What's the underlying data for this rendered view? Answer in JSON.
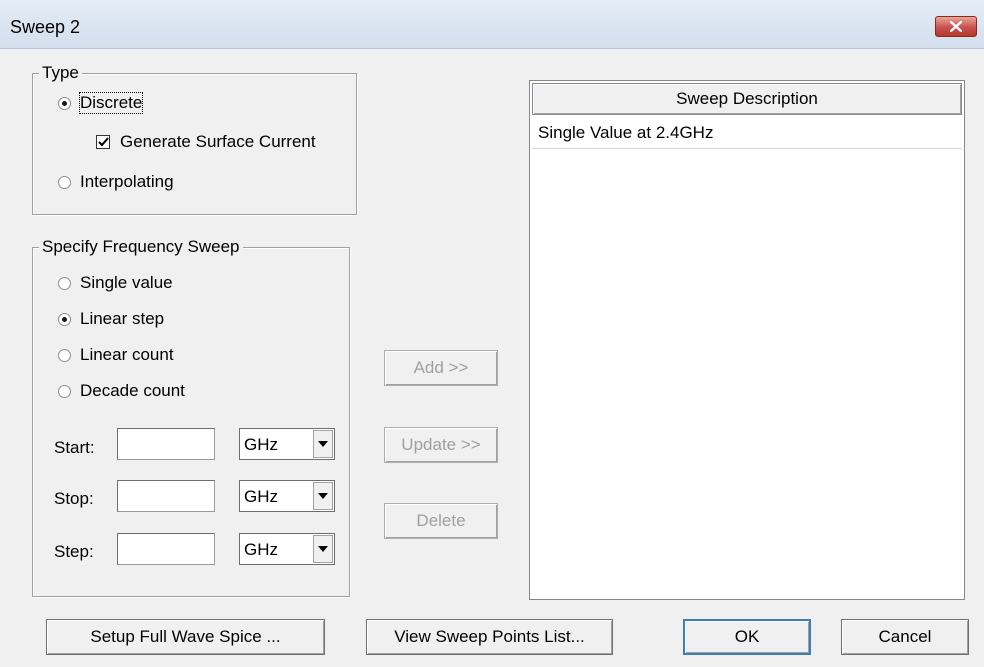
{
  "window": {
    "title": "Sweep 2"
  },
  "type_group": {
    "label": "Type",
    "options": [
      {
        "label": "Discrete",
        "checked": true
      },
      {
        "label": "Interpolating",
        "checked": false
      }
    ],
    "generate_surface_current": {
      "label": "Generate Surface Current",
      "checked": true
    }
  },
  "frequency_group": {
    "label": "Specify Frequency Sweep",
    "options": [
      {
        "label": "Single value",
        "checked": false
      },
      {
        "label": "Linear step",
        "checked": true
      },
      {
        "label": "Linear count",
        "checked": false
      },
      {
        "label": "Decade count",
        "checked": false
      }
    ],
    "fields": [
      {
        "label": "Start:",
        "value": "",
        "unit": "GHz"
      },
      {
        "label": "Stop:",
        "value": "",
        "unit": "GHz"
      },
      {
        "label": "Step:",
        "value": "",
        "unit": "GHz"
      }
    ]
  },
  "middle_buttons": {
    "add": "Add >>",
    "update": "Update >>",
    "delete": "Delete"
  },
  "sweep_list": {
    "header": "Sweep Description",
    "rows": [
      "Single Value at 2.4GHz"
    ]
  },
  "bottom_buttons": {
    "setup": "Setup Full Wave Spice ...",
    "view_points": "View Sweep Points List...",
    "ok": "OK",
    "cancel": "Cancel"
  },
  "icons": {
    "close": "close-icon",
    "checkmark": "checkmark-icon",
    "dropdown": "chevron-down-icon"
  }
}
